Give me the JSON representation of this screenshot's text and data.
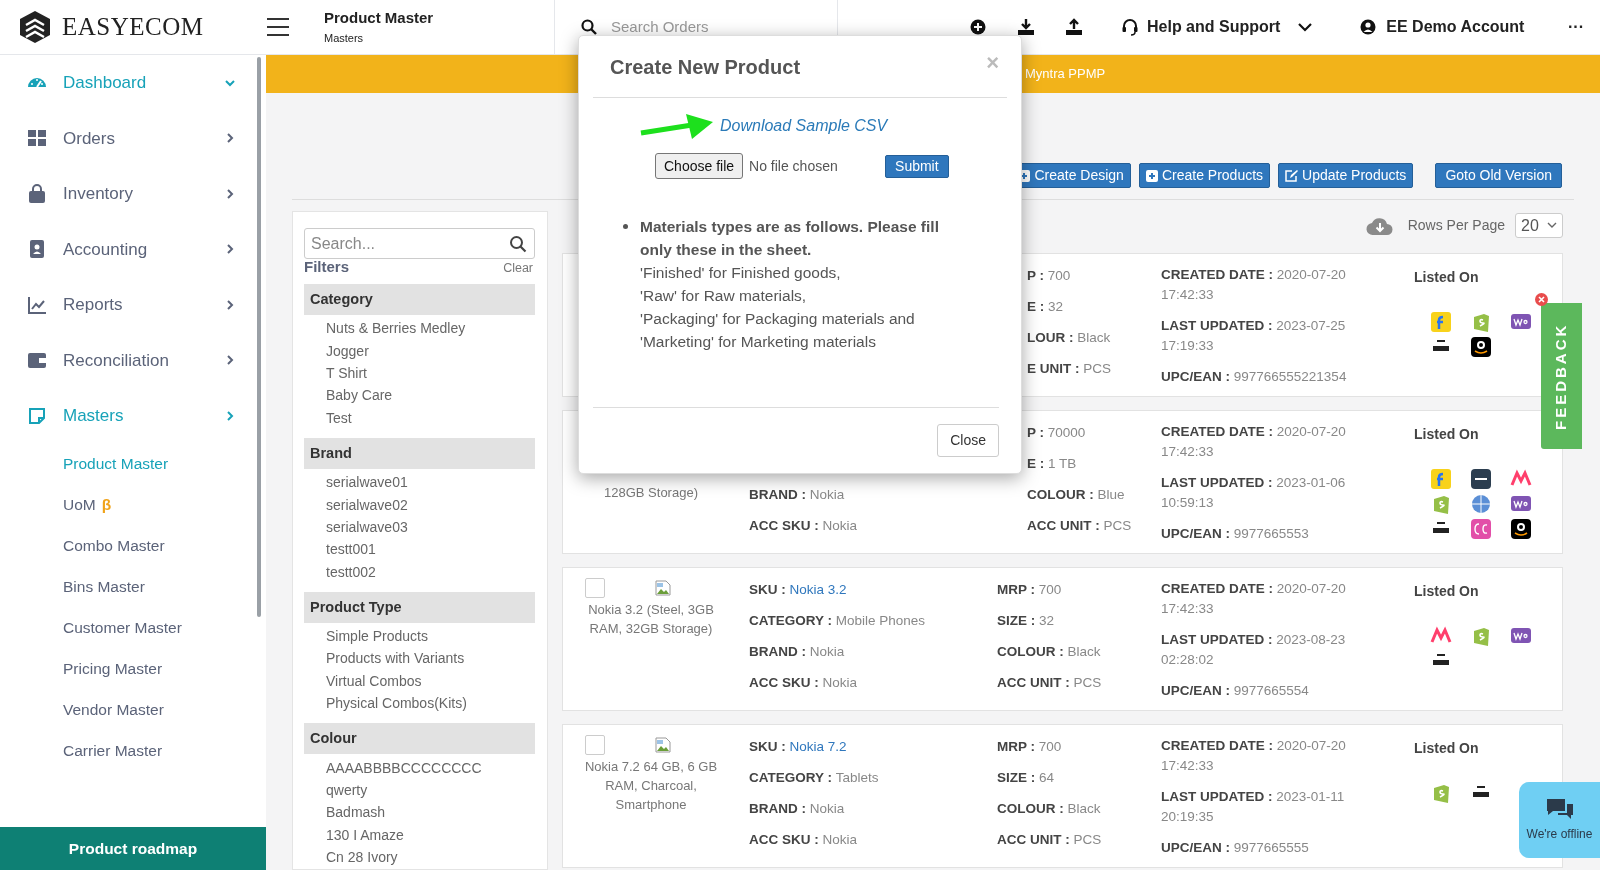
{
  "brand": {
    "name": "EASYECOM"
  },
  "header": {
    "title": "Product Master",
    "subtitle": "Masters",
    "search": {
      "placeholder": "Search Orders"
    },
    "help": "Help and Support",
    "account": "EE Demo Account",
    "more": "···"
  },
  "sidebar": {
    "items": [
      {
        "label": "Dashboard",
        "active": true,
        "expanded": true
      },
      {
        "label": "Orders",
        "active": false,
        "expanded": false
      },
      {
        "label": "Inventory",
        "active": false,
        "expanded": false
      },
      {
        "label": "Accounting",
        "active": false,
        "expanded": false
      },
      {
        "label": "Reports",
        "active": false,
        "expanded": false
      },
      {
        "label": "Reconciliation",
        "active": false,
        "expanded": false
      },
      {
        "label": "Masters",
        "active": true,
        "expanded": false,
        "children": [
          {
            "label": "Product Master",
            "selected": true
          },
          {
            "label": "UoM",
            "badge": "β",
            "selected": false
          },
          {
            "label": "Combo Master",
            "selected": false
          },
          {
            "label": "Bins Master",
            "selected": false
          },
          {
            "label": "Customer Master",
            "selected": false
          },
          {
            "label": "Pricing Master",
            "selected": false
          },
          {
            "label": "Vendor Master",
            "selected": false
          },
          {
            "label": "Carrier Master",
            "selected": false
          }
        ]
      }
    ],
    "footer_button": "Product roadmap"
  },
  "banner": {
    "text": "Myntra PPMP"
  },
  "toolbar": {
    "buttons": [
      {
        "label": "Create Design",
        "kind": "plus"
      },
      {
        "label": "Create Products",
        "kind": "plus"
      },
      {
        "label": "Update Products",
        "kind": "edit"
      },
      {
        "label": "Goto Old Version",
        "kind": "plain"
      }
    ]
  },
  "rows_per_page": {
    "label": "Rows Per Page",
    "value": "20"
  },
  "filters": {
    "search": {
      "placeholder": "Search..."
    },
    "title": "Filters",
    "clear": "Clear",
    "groups": [
      {
        "title": "Category",
        "options": [
          "Nuts & Berries Medley",
          "Jogger",
          "T Shirt",
          "Baby Care",
          "Test"
        ]
      },
      {
        "title": "Brand",
        "options": [
          "serialwave01",
          "serialwave02",
          "serialwave03",
          "testt001",
          "testt002"
        ]
      },
      {
        "title": "Product Type",
        "options": [
          "Simple Products",
          "Products with Variants",
          "Virtual Combos",
          "Physical Combos(Kits)"
        ]
      },
      {
        "title": "Colour",
        "options": [
          "AAAABBBBCCCCCCCC",
          "qwerty",
          "Badmash",
          "130 I Amaze",
          "Cn 28 Ivory"
        ]
      }
    ]
  },
  "products": [
    {
      "partly_hidden": true,
      "col3": [
        {
          "label": "P :",
          "value": "700"
        },
        {
          "label": "E :",
          "value": "32"
        },
        {
          "label": "LOUR :",
          "value": "Black"
        },
        {
          "label": "E UNIT :",
          "value": "PCS"
        }
      ],
      "col4": [
        {
          "label": "CREATED DATE :",
          "value": "2020-07-20 17:42:33"
        },
        {
          "label": "LAST UPDATED :",
          "value": "2023-07-25 17:19:33"
        },
        {
          "label": "UPC/EAN :",
          "value": "997766555221354"
        }
      ],
      "listed_on": "Listed On",
      "channels": [
        {
          "kind": "flipkart"
        },
        {
          "kind": "shopify"
        },
        {
          "kind": "woo"
        },
        {
          "kind": "tatacliq"
        },
        {
          "kind": "amazon"
        }
      ]
    },
    {
      "partly_hidden": true,
      "name": "128GB Storage)",
      "col2": [
        {
          "label": "BRAND :",
          "value": "Nokia"
        },
        {
          "label": "ACC SKU :",
          "value": "Nokia"
        }
      ],
      "col3": [
        {
          "label": "P :",
          "value": "70000"
        },
        {
          "label": "E :",
          "value": "1 TB"
        },
        {
          "label": "COLOUR :",
          "value": "Blue"
        },
        {
          "label": "ACC UNIT :",
          "value": "PCS"
        }
      ],
      "col4": [
        {
          "label": "CREATED DATE :",
          "value": "2020-07-20 17:42:33"
        },
        {
          "label": "LAST UPDATED :",
          "value": "2023-01-06 10:59:13"
        },
        {
          "label": "UPC/EAN :",
          "value": "9977665553"
        }
      ],
      "listed_on": "Listed On",
      "channels": [
        {
          "kind": "flipkart"
        },
        {
          "kind": "ajio"
        },
        {
          "kind": "myntra"
        },
        {
          "kind": "shopify"
        },
        {
          "kind": "globe"
        },
        {
          "kind": "woo"
        },
        {
          "kind": "tatacliq"
        },
        {
          "kind": "fc"
        },
        {
          "kind": "amazon"
        }
      ]
    },
    {
      "partly_hidden": false,
      "checked": false,
      "name": "Nokia 3.2 (Steel, 3GB RAM, 32GB Storage)",
      "col2": [
        {
          "label": "SKU :",
          "value": "Nokia 3.2",
          "link": true
        },
        {
          "label": "CATEGORY :",
          "value": "Mobile Phones"
        },
        {
          "label": "BRAND :",
          "value": "Nokia"
        },
        {
          "label": "ACC SKU :",
          "value": "Nokia"
        }
      ],
      "col3": [
        {
          "label": "MRP :",
          "value": "700"
        },
        {
          "label": "SIZE :",
          "value": "32"
        },
        {
          "label": "COLOUR :",
          "value": "Black"
        },
        {
          "label": "ACC UNIT :",
          "value": "PCS"
        }
      ],
      "col4": [
        {
          "label": "CREATED DATE :",
          "value": "2020-07-20 17:42:33"
        },
        {
          "label": "LAST UPDATED :",
          "value": "2023-08-23 02:28:02"
        },
        {
          "label": "UPC/EAN :",
          "value": "9977665554"
        }
      ],
      "listed_on": "Listed On",
      "channels": [
        {
          "kind": "myntra"
        },
        {
          "kind": "shopify"
        },
        {
          "kind": "woo"
        },
        {
          "kind": "tatacliq"
        }
      ]
    },
    {
      "partly_hidden": false,
      "checked": false,
      "name": "Nokia 7.2 64 GB, 6 GB RAM, Charcoal, Smartphone",
      "col2": [
        {
          "label": "SKU :",
          "value": "Nokia 7.2",
          "link": true
        },
        {
          "label": "CATEGORY :",
          "value": "Tablets"
        },
        {
          "label": "BRAND :",
          "value": "Nokia"
        },
        {
          "label": "ACC SKU :",
          "value": "Nokia"
        }
      ],
      "col3": [
        {
          "label": "MRP :",
          "value": "700"
        },
        {
          "label": "SIZE :",
          "value": "64"
        },
        {
          "label": "COLOUR :",
          "value": "Black"
        },
        {
          "label": "ACC UNIT :",
          "value": "PCS"
        }
      ],
      "col4": [
        {
          "label": "CREATED DATE :",
          "value": "2020-07-20 17:42:33"
        },
        {
          "label": "LAST UPDATED :",
          "value": "2023-01-11 20:19:35"
        },
        {
          "label": "UPC/EAN :",
          "value": "9977665555"
        }
      ],
      "listed_on": "Listed On",
      "channels": [
        {
          "kind": "shopify"
        },
        {
          "kind": "tatacliq"
        }
      ]
    }
  ],
  "modal": {
    "title": "Create New Product",
    "close_x": "×",
    "link": "Download Sample CSV",
    "file_button": "Choose file",
    "file_status": "No file chosen",
    "submit": "Submit",
    "note_bold": "Materials types are as follows. Please fill only these in the sheet.",
    "note_lines": [
      "'Finished' for Finished goods,",
      "'Raw' for Raw materials,",
      "'Packaging' for Packaging materials and",
      "'Marketing' for Marketing materials"
    ],
    "close": "Close"
  },
  "feedback": "FEEDBACK",
  "chat": "We're offline"
}
